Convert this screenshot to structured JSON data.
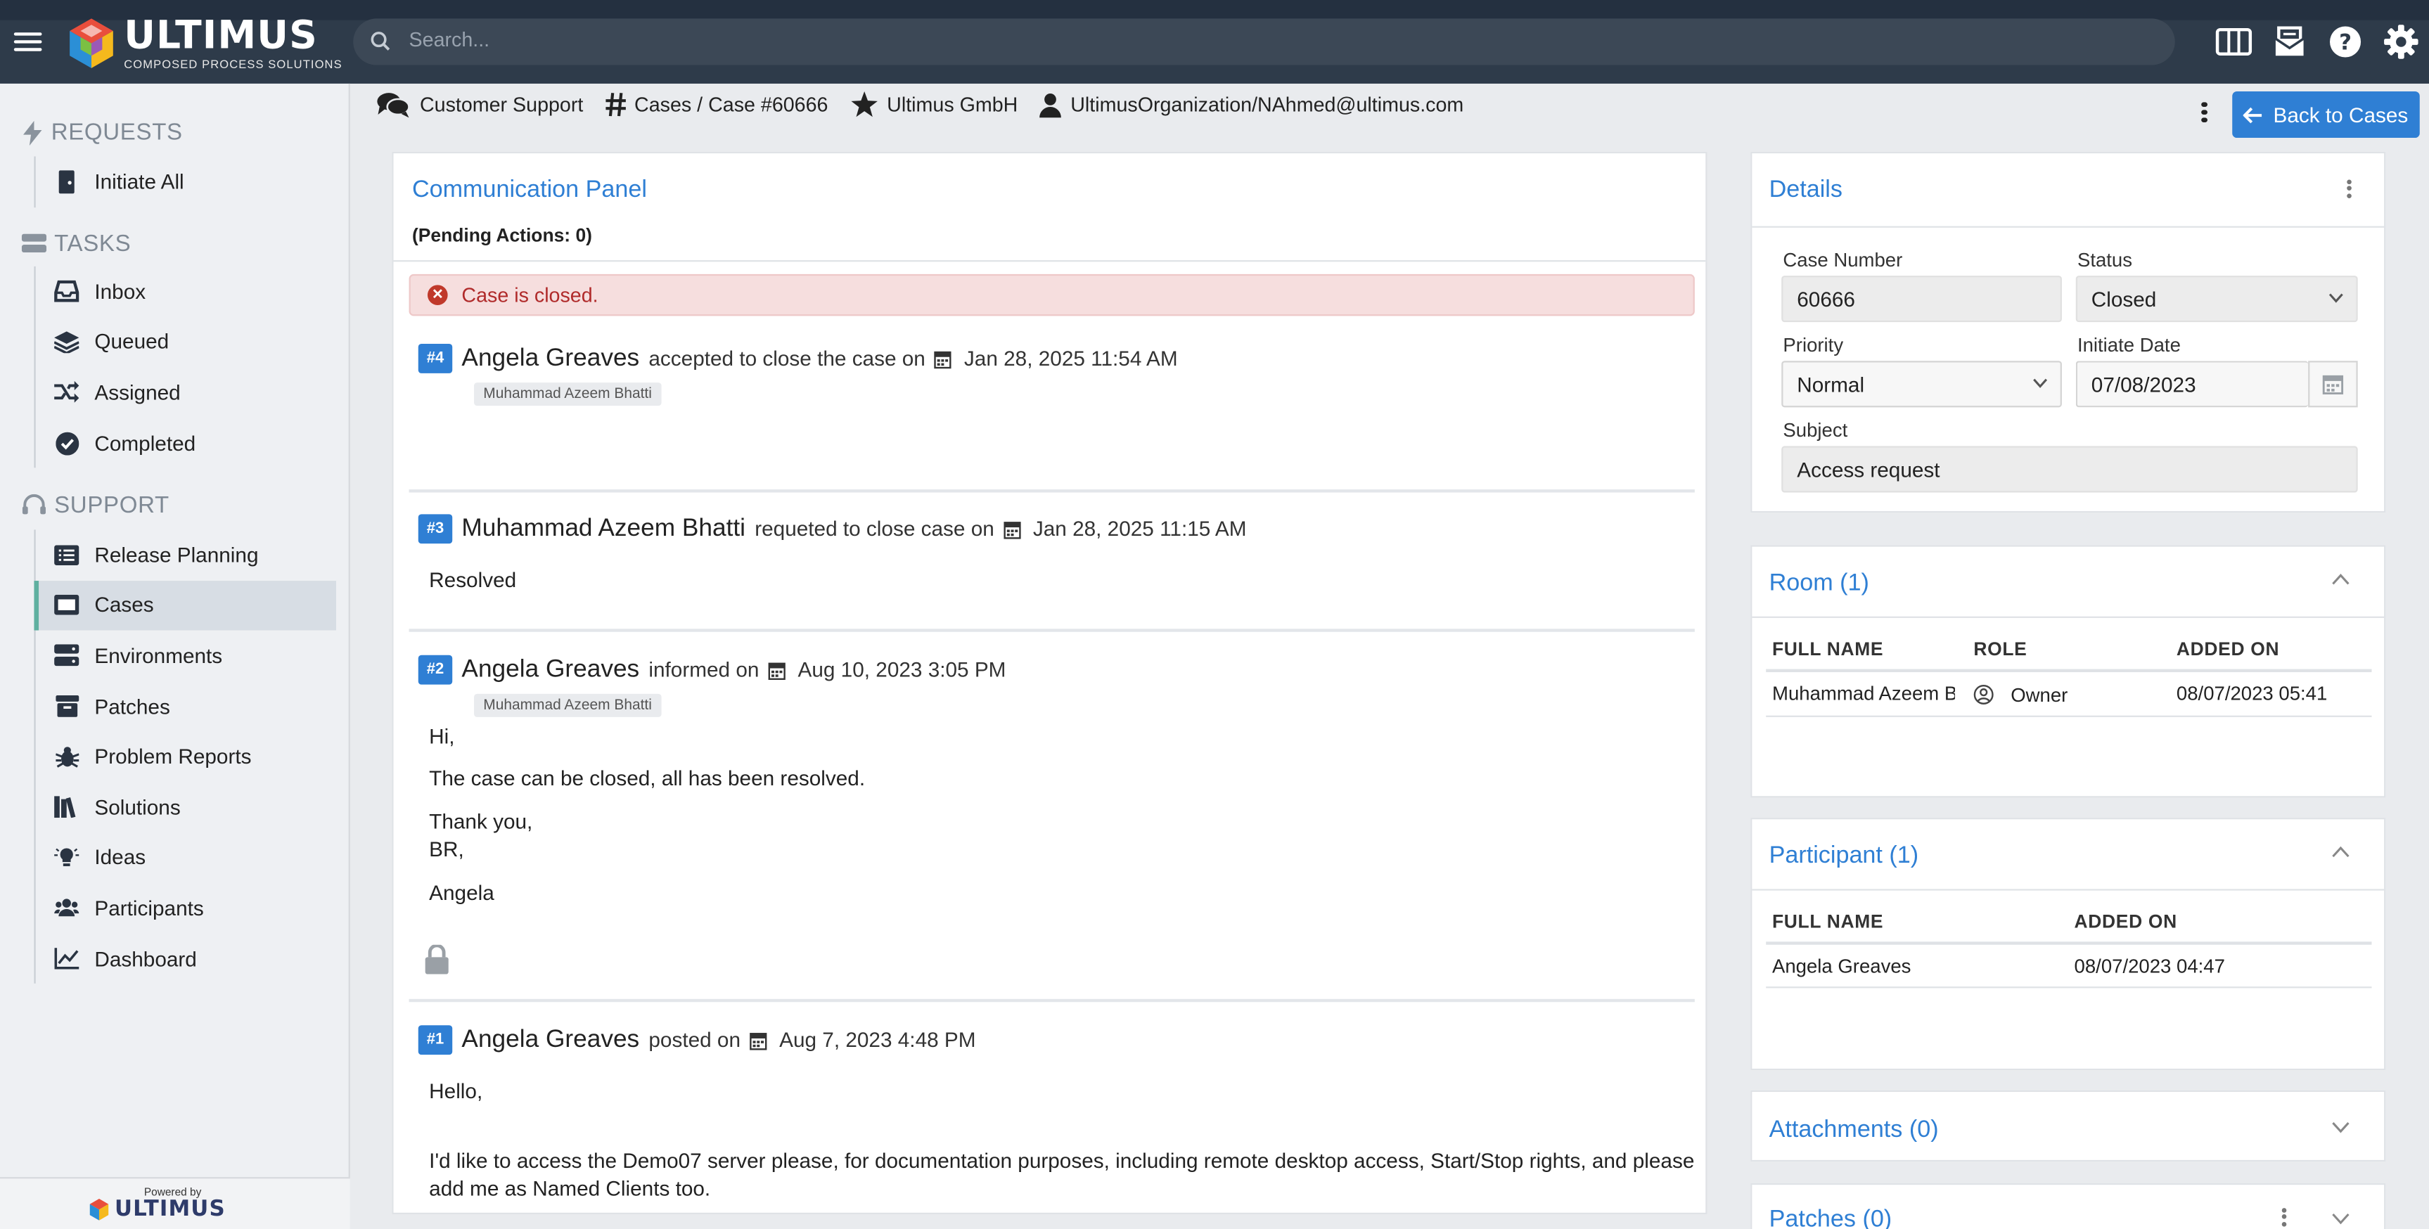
{
  "app": {
    "brand": "ULTIMUS",
    "tagline": "COMPOSED PROCESS SOLUTIONS"
  },
  "search": {
    "placeholder": "Search..."
  },
  "topbar_icons": [
    "columns-icon",
    "inbox-tray-icon",
    "help-icon",
    "gear-icon"
  ],
  "sidebar": {
    "requests_label": "REQUESTS",
    "requests_items": [
      {
        "label": "Initiate All",
        "icon": "door-icon"
      }
    ],
    "tasks_label": "TASKS",
    "tasks_items": [
      {
        "label": "Inbox",
        "icon": "inbox-icon"
      },
      {
        "label": "Queued",
        "icon": "layers-icon"
      },
      {
        "label": "Assigned",
        "icon": "shuffle-icon"
      },
      {
        "label": "Completed",
        "icon": "check-circle-icon"
      }
    ],
    "support_label": "SUPPORT",
    "support_items": [
      {
        "label": "Release Planning",
        "icon": "list-icon"
      },
      {
        "label": "Cases",
        "icon": "case-icon",
        "active": true
      },
      {
        "label": "Environments",
        "icon": "server-icon"
      },
      {
        "label": "Patches",
        "icon": "archive-icon"
      },
      {
        "label": "Problem Reports",
        "icon": "bug-icon"
      },
      {
        "label": "Solutions",
        "icon": "books-icon"
      },
      {
        "label": "Ideas",
        "icon": "lightbulb-icon"
      },
      {
        "label": "Participants",
        "icon": "users-icon"
      },
      {
        "label": "Dashboard",
        "icon": "chart-line-icon"
      }
    ],
    "powered_by": "Powered by",
    "powered_brand": "ULTIMUS"
  },
  "breadcrumb": {
    "area": "Customer Support",
    "cases": "Cases / Case #60666",
    "company": "Ultimus GmbH",
    "user": "UltimusOrganization/NAhmed@ultimus.com"
  },
  "back_button": "Back to Cases",
  "communication": {
    "title": "Communication Panel",
    "pending": "(Pending Actions: 0)",
    "alert": "Case is closed.",
    "messages": [
      {
        "num": "#4",
        "author": "Angela Greaves",
        "action": "accepted to close the case on",
        "date": "Jan 28, 2025 11:54 AM",
        "chip": "Muhammad Azeem Bhatti"
      },
      {
        "num": "#3",
        "author": "Muhammad Azeem Bhatti",
        "action": "requeted to close case on",
        "date": "Jan 28, 2025 11:15 AM",
        "body": "Resolved"
      },
      {
        "num": "#2",
        "author": "Angela Greaves",
        "action": "informed on",
        "date": "Aug 10, 2023 3:05 PM",
        "chip": "Muhammad Azeem Bhatti",
        "body1": "Hi,",
        "body2": "The case can be closed, all has been resolved.",
        "body3": "Thank you,",
        "body4": "BR,",
        "body5": "Angela"
      },
      {
        "num": "#1",
        "author": "Angela Greaves",
        "action": "posted on",
        "date": "Aug 7, 2023 4:48 PM",
        "body1": "Hello,",
        "body2": "I'd like to access the Demo07 server please, for documentation purposes, including remote desktop access, Start/Stop rights, and please",
        "body3": "add me as Named Clients too."
      }
    ]
  },
  "details": {
    "title": "Details",
    "case_number_label": "Case Number",
    "case_number": "60666",
    "status_label": "Status",
    "status": "Closed",
    "priority_label": "Priority",
    "priority": "Normal",
    "initiate_date_label": "Initiate Date",
    "initiate_date": "07/08/2023",
    "subject_label": "Subject",
    "subject": "Access request"
  },
  "room": {
    "title": "Room (1)",
    "headers": [
      "FULL NAME",
      "ROLE",
      "ADDED ON"
    ],
    "rows": [
      {
        "name": "Muhammad Azeem Bh",
        "role": "Owner",
        "added": "08/07/2023 05:41"
      }
    ]
  },
  "participant": {
    "title": "Participant (1)",
    "headers": [
      "FULL NAME",
      "ADDED ON"
    ],
    "rows": [
      {
        "name": "Angela Greaves",
        "added": "08/07/2023 04:47"
      }
    ]
  },
  "attachments": {
    "title": "Attachments (0)"
  },
  "patches": {
    "title": "Patches (0)"
  },
  "colors": {
    "accent": "#2f7fd4",
    "topbar": "#2e3b4a",
    "alert_bg": "#f6dede",
    "alert_text": "#b02a2a",
    "active_marker": "#5fb0a0"
  }
}
